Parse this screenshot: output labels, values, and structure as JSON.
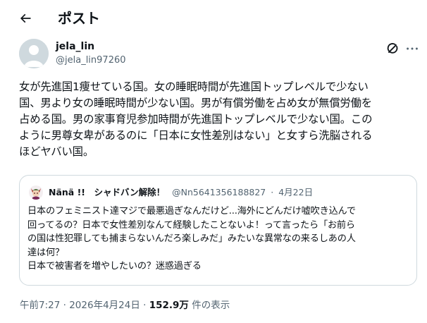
{
  "header": {
    "title": "ポスト"
  },
  "author": {
    "display_name": "jela_lin",
    "handle": "@jela_lin97260"
  },
  "tweet": {
    "text": "女が先進国1痩せている国。女の睡眠時間が先進国トップレベルで少ない\n国、男より女の睡眠時間が少ない国。男が有償労働を占め女が無償労働を\n占める国。男の家事育児参加時間が先進国トップレベルで少ない国。この\nように男尊女卑があるのに「日本に女性差別はない」と女すら洗脳される\nほどヤバい国。"
  },
  "quote": {
    "name": "Nänä !!　シャドバン解除！",
    "handle": "@Nn5641356188827",
    "separator": "·",
    "date": "4月22日",
    "text": "日本のフェミニスト達マジで最悪過ぎなんだけど...海外にどんだけ嘘吹き込んで\n回ってるの？日本で女性差別なんて経験したことないよ！って言ったら「お前ら\nの国は性犯罪しても捕まらないんだろ楽しみだ」みたいな異常なの来るしあの人\n達は何？\n日本で被害者を増やしたいの？迷惑過ぎる"
  },
  "footer": {
    "time": "午前7:27",
    "separator": "·",
    "date": "2026年4月24日",
    "views_count": "152.9万",
    "views_label": "件の表示"
  },
  "icons": {
    "back": "arrow-left-icon",
    "grok": "grok-icon",
    "more": "more-horizontal-icon"
  }
}
